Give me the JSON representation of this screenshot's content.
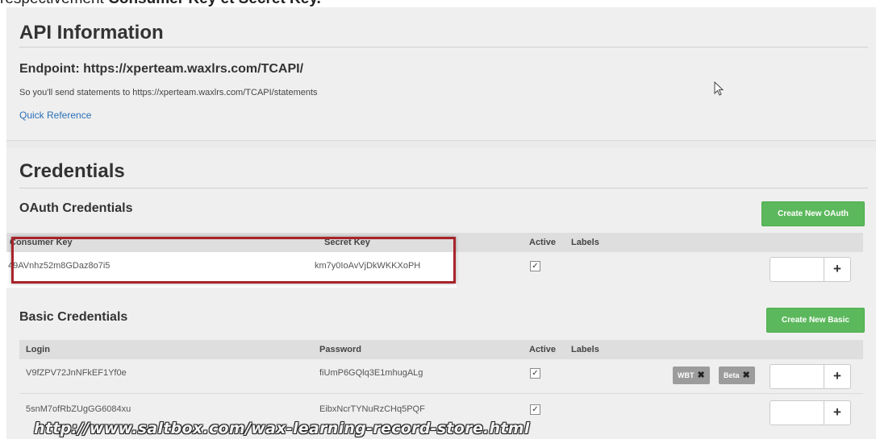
{
  "caption": {
    "text_before": "respectivement ",
    "text_bold": "Consumer Key et Secret Key."
  },
  "api": {
    "title": "API Information",
    "endpoint": "Endpoint: https://xperteam.waxlrs.com/TCAPI/",
    "note": "So you'll send statements to https://xperteam.waxlrs.com/TCAPI/statements",
    "quick_reference": "Quick Reference"
  },
  "credentials": {
    "title": "Credentials",
    "oauth": {
      "title": "OAuth Credentials",
      "create_button": "Create New OAuth",
      "headers": {
        "key": "Consumer Key",
        "secret": "Secret Key",
        "active": "Active",
        "labels": "Labels"
      },
      "rows": [
        {
          "key": "49AVnhz52m8GDaz8o7i5",
          "secret": "km7y0IoAvVjDkWKKXoPH",
          "active": true
        }
      ]
    },
    "basic": {
      "title": "Basic Credentials",
      "create_button": "Create New Basic",
      "headers": {
        "login": "Login",
        "password": "Password",
        "active": "Active",
        "labels": "Labels"
      },
      "rows": [
        {
          "login": "V9fZPV72JnNFkEF1Yf0e",
          "password": "fiUmP6GQlq3E1mhugALg",
          "active": true,
          "tags": [
            "WBT",
            "Beta"
          ]
        },
        {
          "login": "5snM7ofRbZUgGG6084xu",
          "password": "EibxNcrTYNuRzCHq5PQF",
          "active": true,
          "tags": []
        }
      ]
    },
    "plus_label": "+",
    "checkmark": "✓"
  },
  "watermark": "http://www.saltbox.com/wax-learning-record-store.html",
  "colors": {
    "accent_green": "#5cb85c",
    "highlight_red": "#a8232a",
    "link_blue": "#2a6fb6"
  }
}
